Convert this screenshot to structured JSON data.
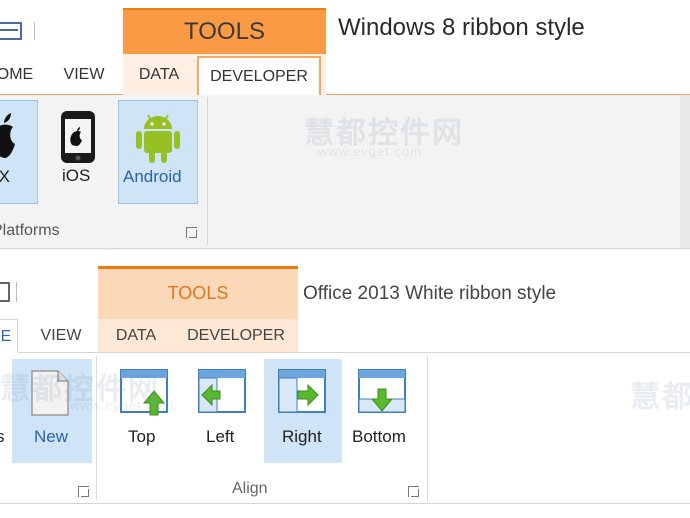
{
  "top_ribbon": {
    "contextual_tab": "TOOLS",
    "window_title": "Windows 8 ribbon style",
    "tabs": [
      "OME",
      "VIEW",
      "DATA",
      "DEVELOPER"
    ],
    "active_tab": "DEVELOPER",
    "buttons": [
      {
        "label": "-X",
        "icon": "apple-icon"
      },
      {
        "label": "iOS",
        "icon": "iphone-icon"
      },
      {
        "label": "Android",
        "icon": "android-icon"
      }
    ],
    "group_label": "Platforms"
  },
  "bottom_ribbon": {
    "contextual_tab": "TOOLS",
    "window_title": "Office 2013 White ribbon style",
    "tabs": [
      "E",
      "VIEW",
      "DATA",
      "DEVELOPER"
    ],
    "active_tab": "E",
    "partial_label": "s",
    "new_label": "New",
    "align_buttons": [
      {
        "label": "Top",
        "icon": "align-top-icon"
      },
      {
        "label": "Left",
        "icon": "align-left-icon"
      },
      {
        "label": "Right",
        "icon": "align-right-icon"
      },
      {
        "label": "Bottom",
        "icon": "align-bottom-icon"
      }
    ],
    "group_label": "Align"
  },
  "watermark": {
    "text": "慧都控件网",
    "url": "www.evget.com"
  },
  "colors": {
    "accent_orange": "#f07a12",
    "tools_fill_top": "#fb9a44",
    "tools_fill_bottom": "#fbd8b8",
    "selected_blue": "#cfe4f7",
    "android_green": "#97c024",
    "arrow_green": "#58b82e"
  }
}
